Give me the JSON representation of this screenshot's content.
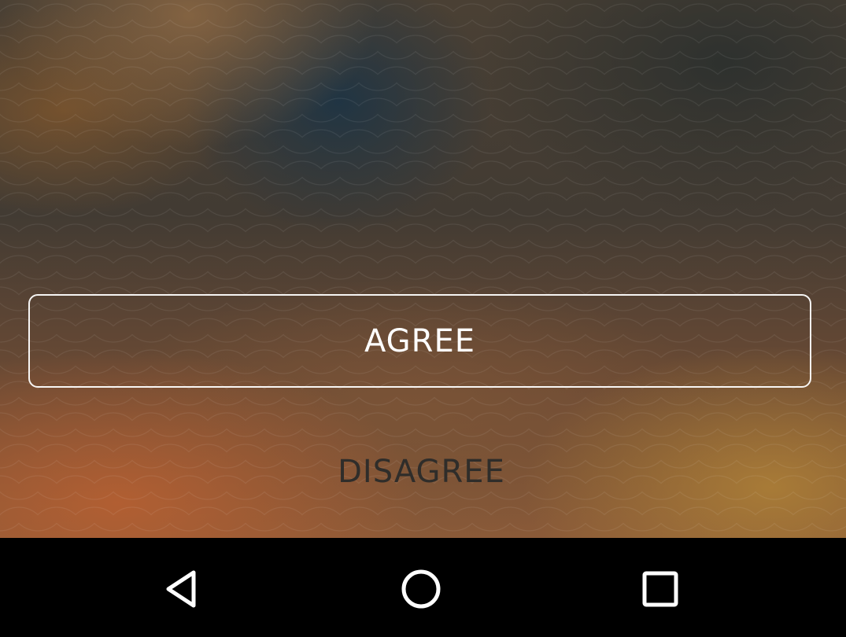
{
  "dialog": {
    "agree_label": "AGREE",
    "disagree_label": "DISAGREE"
  },
  "navigation_bar": {
    "icons": [
      "back-icon",
      "home-icon",
      "recents-icon"
    ]
  }
}
